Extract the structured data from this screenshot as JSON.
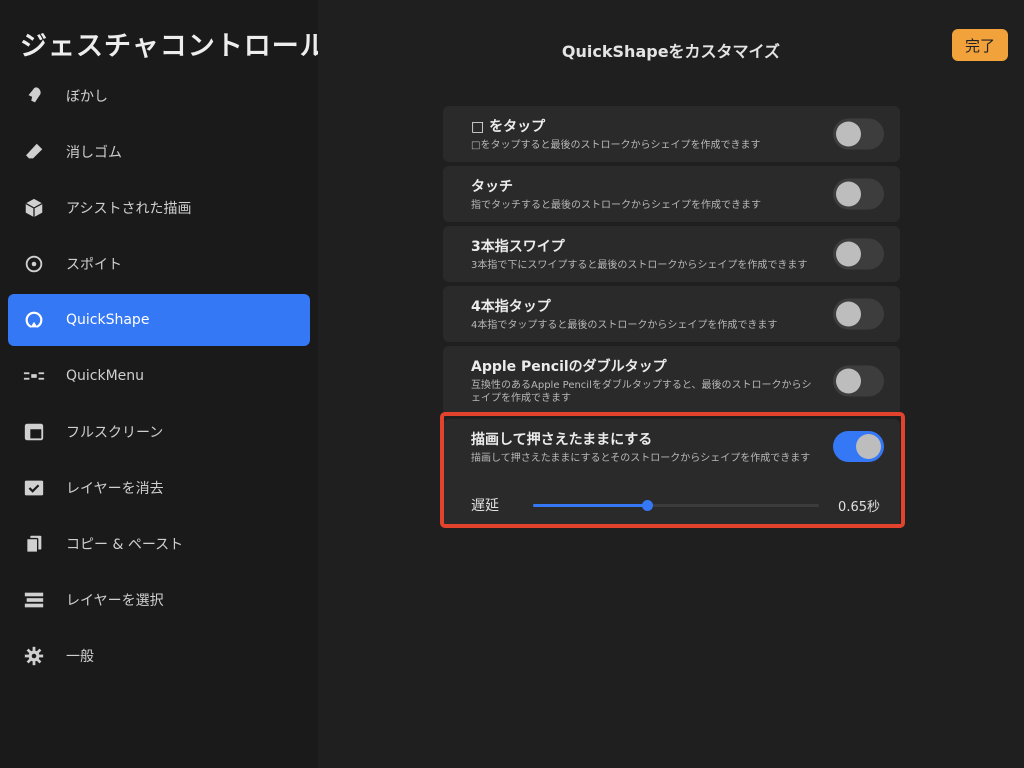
{
  "sidebar": {
    "title": "ジェスチャコントロール",
    "items": [
      {
        "label": "ぼかし",
        "icon": "smudge-icon"
      },
      {
        "label": "消しゴム",
        "icon": "eraser-icon"
      },
      {
        "label": "アシストされた描画",
        "icon": "cube-icon"
      },
      {
        "label": "スポイト",
        "icon": "eyedropper-icon"
      },
      {
        "label": "QuickShape",
        "icon": "quickshape-icon",
        "active": true
      },
      {
        "label": "QuickMenu",
        "icon": "quickmenu-icon"
      },
      {
        "label": "フルスクリーン",
        "icon": "fullscreen-icon"
      },
      {
        "label": "レイヤーを消去",
        "icon": "clear-layer-icon"
      },
      {
        "label": "コピー & ペースト",
        "icon": "copy-paste-icon"
      },
      {
        "label": "レイヤーを選択",
        "icon": "layer-select-icon"
      },
      {
        "label": "一般",
        "icon": "gear-icon"
      }
    ]
  },
  "main": {
    "title": "QuickShapeをカスタマイズ",
    "done_label": "完了",
    "rows": [
      {
        "title": "□ をタップ",
        "desc": "□をタップすると最後のストロークからシェイプを作成できます",
        "on": false
      },
      {
        "title": "タッチ",
        "desc": "指でタッチすると最後のストロークからシェイプを作成できます",
        "on": false
      },
      {
        "title": "3本指スワイプ",
        "desc": "3本指で下にスワイプすると最後のストロークからシェイプを作成できます",
        "on": false
      },
      {
        "title": "4本指タップ",
        "desc": "4本指でタップすると最後のストロークからシェイプを作成できます",
        "on": false
      },
      {
        "title": "Apple Pencilのダブルタップ",
        "desc": "互換性のあるApple Pencilをダブルタップすると、最後のストロークからシェイプを作成できます",
        "on": false
      }
    ],
    "hold": {
      "title": "描画して押さえたままにする",
      "desc": "描画して押さえたままにするとそのストロークからシェイプを作成できます",
      "on": true,
      "slider_label": "遅延",
      "slider_value": "0.65秒",
      "slider_fraction": 0.4
    }
  },
  "colors": {
    "accent": "#3478f6",
    "done": "#f2a23a",
    "highlight": "#e1432d"
  }
}
